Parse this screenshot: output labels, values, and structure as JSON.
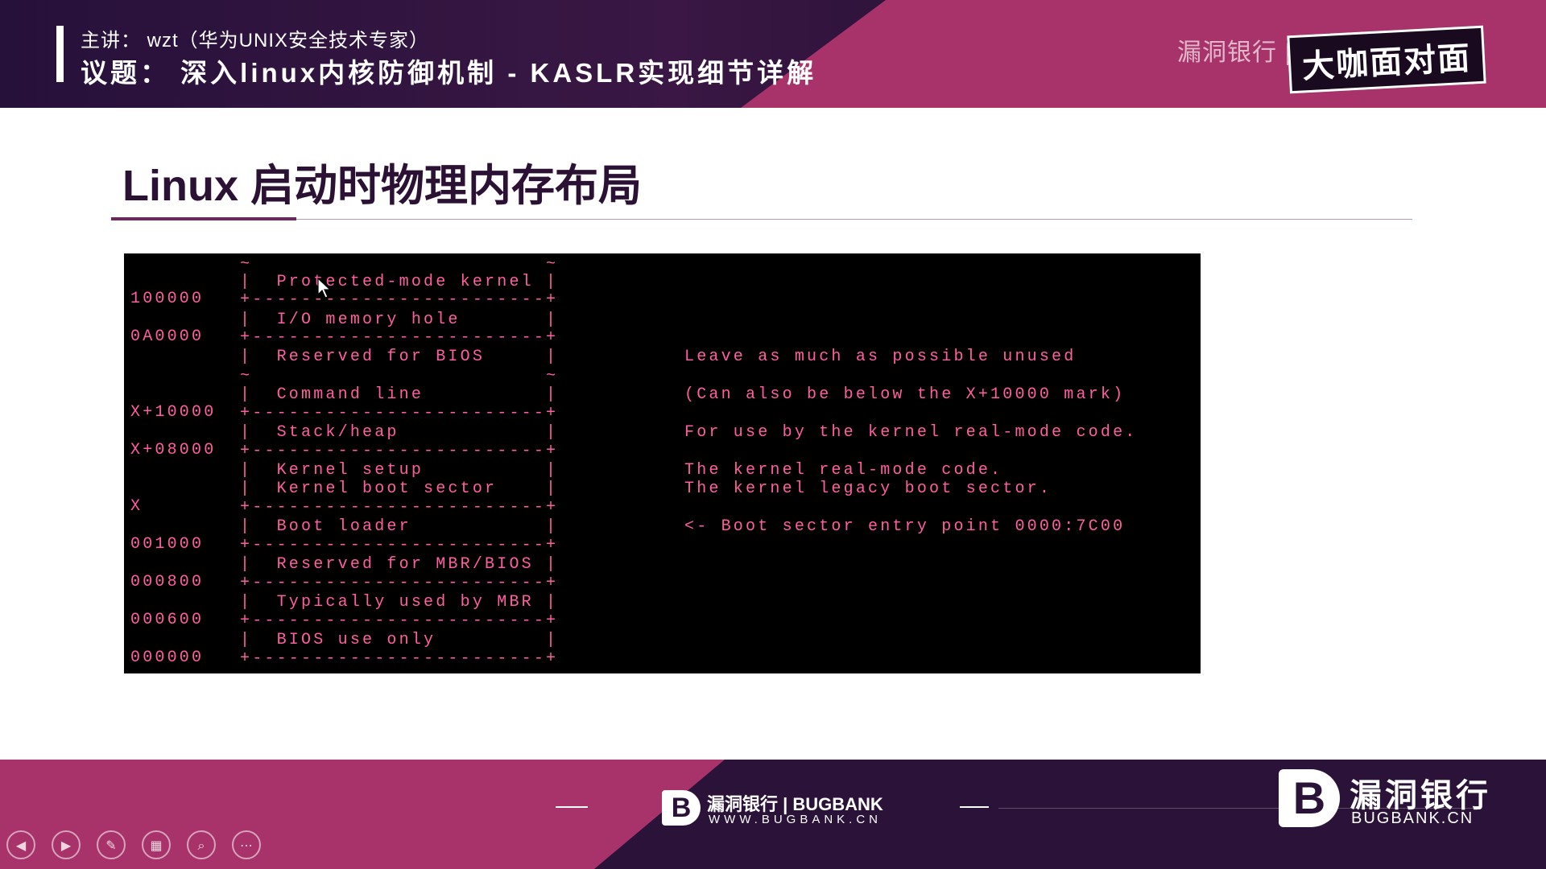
{
  "header": {
    "speaker": "主讲： wzt（华为UNIX安全技术专家）",
    "topic": "议题： 深入linux内核防御机制 - KASLR实现细节详解",
    "brand_overlay": "漏洞银行 | BUGBANK",
    "show_logo": "大咖面对面"
  },
  "slide": {
    "title": "Linux 启动时物理内存布局"
  },
  "terminal": {
    "addresses": [
      "100000",
      "0A0000",
      "X+10000",
      "X+08000",
      "X",
      "001000",
      "000800",
      "000600",
      "000000"
    ],
    "box_lines": [
      "~                        ~",
      "|  Protected-mode kernel |",
      "+------------------------+",
      "|  I/O memory hole       |",
      "+------------------------+",
      "|  Reserved for BIOS     |",
      "~                        ~",
      "|  Command line          |",
      "+------------------------+",
      "|  Stack/heap            |",
      "+------------------------+",
      "|  Kernel setup          |",
      "|  Kernel boot sector    |",
      "+------------------------+",
      "|  Boot loader           |",
      "+------------------------+",
      "|  Reserved for MBR/BIOS |",
      "+------------------------+",
      "|  Typically used by MBR |",
      "+------------------------+",
      "|  BIOS use only         |",
      "+------------------------+"
    ],
    "notes": [
      "Leave as much as possible unused",
      "(Can also be below the X+10000 mark)",
      "For use by the kernel real-mode code.",
      "The kernel real-mode code.",
      "The kernel legacy boot sector.",
      "<- Boot sector entry point 0000:7C00"
    ]
  },
  "footer": {
    "center_logo_glyph": "B",
    "center_name": "漏洞银行 | BUGBANK",
    "center_url": "WWW.BUGBANK.CN",
    "right_logo_glyph": "B",
    "right_name": "漏洞银行",
    "right_url": "BUGBANK.CN"
  },
  "controls": [
    {
      "icon": "prev-icon",
      "glyph": "◀"
    },
    {
      "icon": "next-icon",
      "glyph": "▶"
    },
    {
      "icon": "pen-icon",
      "glyph": "✎"
    },
    {
      "icon": "slides-icon",
      "glyph": "▦"
    },
    {
      "icon": "zoom-icon",
      "glyph": "⌕"
    },
    {
      "icon": "more-icon",
      "glyph": "⋯"
    }
  ]
}
